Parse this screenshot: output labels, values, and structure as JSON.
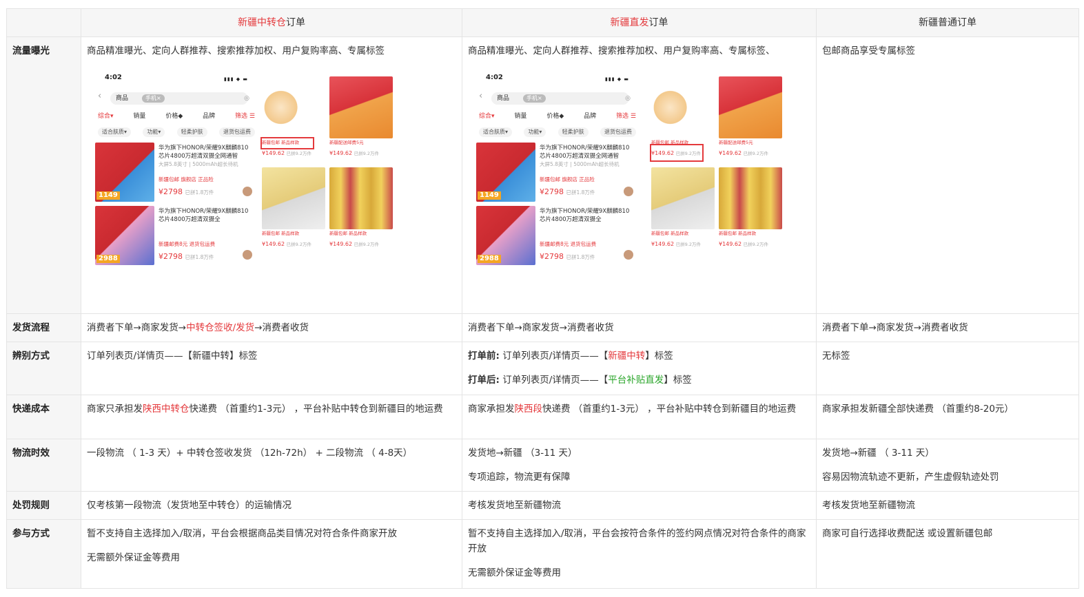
{
  "columns": [
    {
      "red": "新疆中转仓",
      "rest": "订单"
    },
    {
      "red": "新疆直发",
      "rest": "订单"
    },
    {
      "red": "",
      "rest": "新疆普通订单"
    }
  ],
  "rows": {
    "exposure": {
      "label": "流量曝光",
      "c1": "商品精准曝光、定向人群推荐、搜索推荐加权、用户复购率高、专属标签",
      "c2": "商品精准曝光、定向人群推荐、搜索推荐加权、用户复购率高、专属标签、",
      "c3": "包邮商品享受专属标签"
    },
    "flow": {
      "label": "发货流程",
      "c1_a": "消费者下单→商家发货→",
      "c1_red": "中转仓签收/发货",
      "c1_b": "→消费者收货",
      "c2": "消费者下单→商家发货→消费者收货",
      "c3": "消费者下单→商家发货→消费者收货"
    },
    "identify": {
      "label": "辨别方式",
      "c1": "订单列表页/详情页——【新疆中转】标签",
      "c2_before_bold": "打单前:",
      "c2_before_a": " 订单列表页/详情页——【",
      "c2_before_red": "新疆中转",
      "c2_before_b": "】标签",
      "c2_after_bold": "打单后:",
      "c2_after_a": " 订单列表页/详情页——【",
      "c2_after_green": "平台补贴直发",
      "c2_after_b": "】标签",
      "c3": "无标签"
    },
    "cost": {
      "label": "快递成本",
      "c1_a": "商家只承担发",
      "c1_red": "陕西中转仓",
      "c1_b": "快递费 （首重约1-3元） ，平台补贴中转仓到新疆目的地运费",
      "c2_a": "商家承担发",
      "c2_red": "陕西段",
      "c2_b": "快递费 （首重约1-3元） ，平台补贴中转仓到新疆目的地运费",
      "c3": "商家承担发新疆全部快递费 （首重约8-20元）"
    },
    "timing": {
      "label": "物流时效",
      "c1": "一段物流 （ 1-3 天）+ 中转仓签收发货 （12h-72h） + 二段物流 （ 4-8天）",
      "c2_line1": "发货地→新疆 （3-11 天）",
      "c2_line2": "专项追踪，物流更有保障",
      "c3_line1": "发货地→新疆 （ 3-11 天）",
      "c3_line2": "容易因物流轨迹不更新，产生虚假轨迹处罚"
    },
    "penalty": {
      "label": "处罚规则",
      "c1": "仅考核第一段物流（发货地至中转仓）的运输情况",
      "c2": "考核发货地至新疆物流",
      "c3": "考核发货地至新疆物流"
    },
    "join": {
      "label": "参与方式",
      "c1_line1": "暂不支持自主选择加入/取消，平台会根据商品类目情况对符合条件商家开放",
      "c1_line2": "无需额外保证金等费用",
      "c2_line1": "暂不支持自主选择加入/取消，平台会按符合条件的签约网点情况对符合条件的商家开放",
      "c2_line2": "无需额外保证金等费用",
      "c3": "商家可自行选择收费配送 或设置新疆包邮"
    }
  },
  "mockup": {
    "time": "4:02",
    "category": "商品",
    "chip": "手机×",
    "sort": [
      "综合▾",
      "销量",
      "价格◆",
      "品牌",
      "筛选 ☰"
    ],
    "filters": [
      "适合肤质▾",
      "功能▾",
      "轻柔护肤",
      "退货包运费"
    ],
    "item1_title": "华为旗下HONOR/荣耀9X麒麟810芯片4800万超清双摄全网通智",
    "item1_sub": "大屏5.8英寸 | 5000mAh超长待机",
    "item1_tags": "新疆包邮  旗舰店  正品险",
    "item1_price": "¥2798",
    "item1_sold": "已拼1.8万件",
    "item1_badge": "1149",
    "item2_title": "华为旗下HONOR/荣耀9X麒麟810芯片4800万超清双摄全",
    "item2_tags": "新疆邮费8元  退货包运费",
    "item2_price": "¥2798",
    "item2_sold": "已拼1.8万件",
    "item2_badge": "2988",
    "grid_cap1": "新疆包邮  新品样款",
    "grid_cap2": "新疆配送邮费5元",
    "grid_price": "¥149.62",
    "grid_sold": "已拼9.2万件"
  }
}
